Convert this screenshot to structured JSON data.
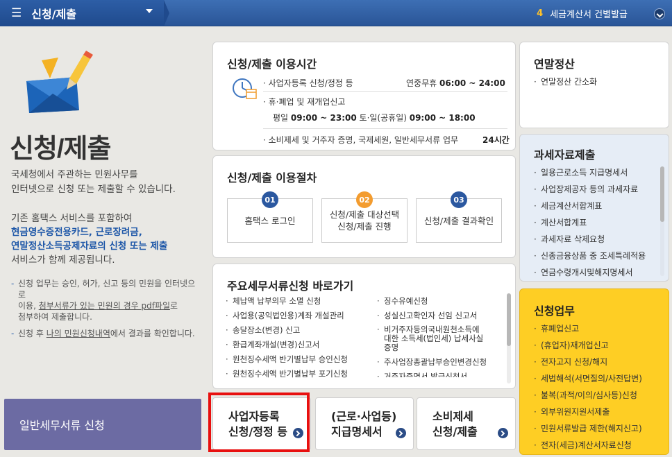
{
  "topbar": {
    "menu_label": "신청/제출",
    "menu_icon": "hamburger-icon",
    "right_num": "4",
    "right_label": "세금계산서 건별발급"
  },
  "hero": {
    "title": "신청/제출",
    "intro_line1": "국세청에서 주관하는 민원사무를",
    "intro_line2": "인터넷으로 신청 또는 제출할 수 있습니다.",
    "intro2_line1": "기존 홈택스 서비스를 포함하여",
    "intro2_hl1": "현금영수증전용카드, 근로장려금,",
    "intro2_hl2": "연말정산소득공제자료의 신청 또는 제출",
    "intro2_line4": "서비스가 함께 제공됩니다.",
    "note1_a": "신청 업무는 승인, 허가, 신고 등의 민원을 인터넷으로",
    "note1_b": "이용, ",
    "note1_u": "첨부서류가 있는 민원의 경우 pdf파일",
    "note1_c": "로",
    "note1_d": "첨부하여 제출합니다.",
    "note2_a": "신청 후 ",
    "note2_u": "나의 민원신청내역",
    "note2_b": "에서 결과를 확인합니다.",
    "general_btn": "일반세무서류 신청"
  },
  "time_card": {
    "title": "신청/제출 이용시간",
    "row1_label": "· 사업자등록 신청/정정 등",
    "row1_pre": "연중무휴 ",
    "row1_time": "06:00 ~ 24:00",
    "row2_label": "· 휴·폐업 및 재개업신고",
    "row3_pre1": "평일 ",
    "row3_time1": "09:00 ~ 23:00",
    "row3_mid": " 토·일(공휴일) ",
    "row3_time2": "09:00 ~ 18:00",
    "row4_label": "· 소비제세 및 거주자 증명, 국제세원, 일반세무서류 업무",
    "row4_time": "24시간"
  },
  "proc_card": {
    "title": "신청/제출 이용절차",
    "steps": [
      {
        "num": "01",
        "l1": "홈택스 로그인",
        "l2": ""
      },
      {
        "num": "02",
        "l1": "신청/제출 대상선택",
        "l2": "신청/제출 진행"
      },
      {
        "num": "03",
        "l1": "신청/제출 결과확인",
        "l2": ""
      }
    ]
  },
  "quick_card": {
    "title": "주요세무서류신청 바로가기",
    "left": [
      "체납액 납부의무 소멸 신청",
      "사업용(공익법인용)계좌 개설관리",
      "송달장소(변경) 신고",
      "환급계좌개설(변경)신고서",
      "원천징수세액 반기별납부 승인신청",
      "원천징수세액 반기별납부 포기신청"
    ],
    "right": [
      "징수유예신청",
      "성실신고확인자 선임 신고서",
      "비거주자등의국내원천소득에",
      "대한 소득세(법인세) 납세사실",
      "증명",
      "주사업장총괄납부승인변경신청",
      "거주자증명서 발급신청서"
    ]
  },
  "bottom_buttons": [
    {
      "l1": "사업자등록",
      "l2": "신청/정정 등"
    },
    {
      "l1": "(근로·사업등)",
      "l2": "지급명세서"
    },
    {
      "l1": "소비제세",
      "l2": "신청/제출"
    }
  ],
  "year_card": {
    "title": "연말정산",
    "items": [
      "연말정산 간소화"
    ]
  },
  "tax_card": {
    "title": "과세자료제출",
    "items": [
      "일용근로소득 지급명세서",
      "사업장제공자 등의 과세자료",
      "세금계산서합계표",
      "계산서합계표",
      "과세자료 삭제요청",
      "신종금융상품 중 조세특례적용",
      "연금수령개시및해지명세서"
    ]
  },
  "req_card": {
    "title": "신청업무",
    "items": [
      "휴폐업신고",
      "(휴업자)재개업신고",
      "전자고지 신청/해지",
      "세법해석(서면질의/사전답변)",
      "불복(과적/이의/심사등)신청",
      "외부위원지원서제출",
      "민원서류발급 제한(해지신고)",
      "전자(세금)계산서자료신청"
    ]
  },
  "colors": {
    "accent": "#2b58a0",
    "highlight": "#fece24",
    "alert": "#e8100f"
  }
}
